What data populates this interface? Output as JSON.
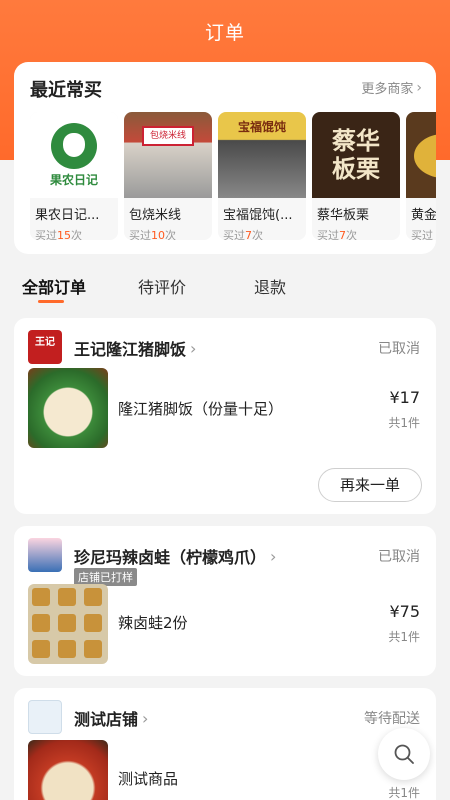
{
  "header": {
    "title": "订单"
  },
  "recent": {
    "heading": "最近常买",
    "more_label": "更多商家",
    "shops": [
      {
        "name": "果农日记...",
        "count_prefix": "买过",
        "count": "15",
        "count_suffix": "次",
        "logo_text": "果农日记"
      },
      {
        "name": "包烧米线",
        "count_prefix": "买过",
        "count": "10",
        "count_suffix": "次",
        "sign_text": "包烧米线"
      },
      {
        "name": "宝福馄饨(...",
        "count_prefix": "买过",
        "count": "7",
        "count_suffix": "次",
        "sign_text": "宝福馄饨"
      },
      {
        "name": "蔡华板栗",
        "count_prefix": "买过",
        "count": "7",
        "count_suffix": "次",
        "sign_text": "蔡华板栗"
      },
      {
        "name": "黄金",
        "count_prefix": "买过",
        "count": "",
        "count_suffix": ""
      }
    ]
  },
  "tabs": [
    {
      "label": "全部订单",
      "active": true
    },
    {
      "label": "待评价",
      "active": false
    },
    {
      "label": "退款",
      "active": false
    }
  ],
  "orders": [
    {
      "shop": "王记隆江猪脚饭",
      "status": "已取消",
      "item": "隆江猪脚饭（份量十足）",
      "price": "¥17",
      "qty": "共1件",
      "action": "再来一单",
      "logo_text": "王记"
    },
    {
      "shop": "珍尼玛辣卤蛙（柠檬鸡爪）",
      "status": "已取消",
      "tag": "店铺已打样",
      "item": "辣卤蛙2份",
      "price": "¥75",
      "qty": "共1件"
    },
    {
      "shop": "测试店铺",
      "status": "等待配送",
      "item": "测试商品",
      "qty": "共1件"
    }
  ],
  "colors": {
    "brand": "#ff6a2b",
    "accent_count": "#ff5a1f"
  },
  "icons": {
    "search": "search-icon",
    "chevron": "chevron-right-icon"
  }
}
